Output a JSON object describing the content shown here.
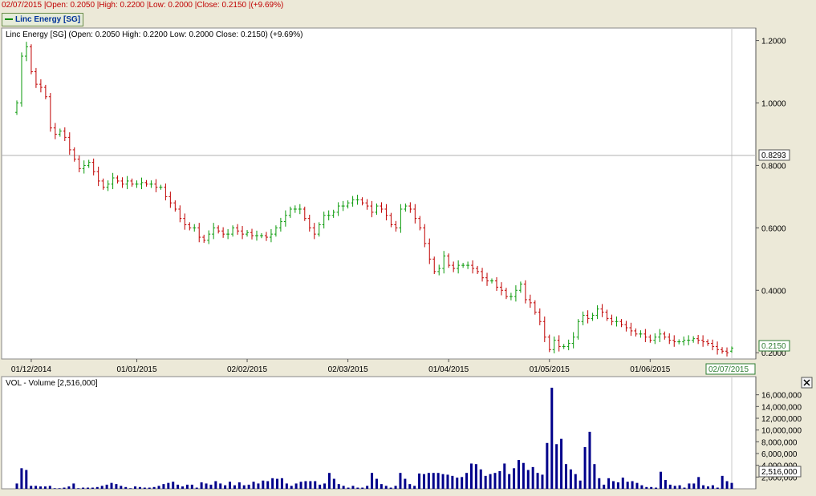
{
  "header": {
    "summary": "02/07/2015 |Open: 0.2050 |High: 0.2200 |Low: 0.2000 |Close: 0.2150 |(+9.69%)"
  },
  "tab": {
    "label": "Linc Energy [SG]"
  },
  "price_panel": {
    "title": "Linc Energy [SG] (Open: 0.2050  High: 0.2200  Low: 0.2000  Close: 0.2150) (+9.69%)",
    "crosshair_value": "0.8293",
    "last_value": "0.2150",
    "last_date": "02/07/2015",
    "colors": {
      "up": "#0a9a0a",
      "down": "#c00000"
    }
  },
  "volume_panel": {
    "title": "VOL - Volume [2,516,000]",
    "last_value": "2,516,000",
    "close_icon": "close-icon",
    "bar_color": "#00008b"
  },
  "chart_data": [
    {
      "type": "ohlc",
      "title": "Linc Energy [SG]",
      "ylim": [
        0.18,
        1.24
      ],
      "yticks": [
        "1.2000",
        "1.0000",
        "0.8000",
        "0.6000",
        "0.4000",
        "0.2000"
      ],
      "xticks": [
        "01/12/2014",
        "01/01/2015",
        "02/02/2015",
        "02/03/2015",
        "01/04/2015",
        "01/05/2015",
        "01/06/2015"
      ],
      "grid": false,
      "last_bar": {
        "date": "02/07/2015",
        "open": 0.205,
        "high": 0.22,
        "low": 0.2,
        "close": 0.215
      },
      "close_values": [
        1.0,
        1.15,
        1.18,
        1.1,
        1.06,
        1.05,
        1.02,
        0.92,
        0.9,
        0.91,
        0.89,
        0.85,
        0.82,
        0.79,
        0.8,
        0.81,
        0.78,
        0.75,
        0.73,
        0.74,
        0.76,
        0.75,
        0.74,
        0.75,
        0.74,
        0.74,
        0.745,
        0.74,
        0.74,
        0.73,
        0.73,
        0.7,
        0.68,
        0.66,
        0.63,
        0.61,
        0.6,
        0.6,
        0.57,
        0.56,
        0.58,
        0.6,
        0.59,
        0.58,
        0.58,
        0.6,
        0.59,
        0.58,
        0.585,
        0.575,
        0.575,
        0.575,
        0.57,
        0.58,
        0.6,
        0.62,
        0.64,
        0.66,
        0.66,
        0.66,
        0.63,
        0.6,
        0.58,
        0.61,
        0.64,
        0.64,
        0.65,
        0.67,
        0.67,
        0.68,
        0.69,
        0.69,
        0.68,
        0.67,
        0.65,
        0.67,
        0.66,
        0.64,
        0.61,
        0.6,
        0.66,
        0.67,
        0.66,
        0.63,
        0.6,
        0.55,
        0.5,
        0.46,
        0.47,
        0.51,
        0.48,
        0.47,
        0.48,
        0.48,
        0.48,
        0.47,
        0.46,
        0.44,
        0.43,
        0.43,
        0.41,
        0.4,
        0.38,
        0.38,
        0.4,
        0.42,
        0.37,
        0.36,
        0.33,
        0.3,
        0.25,
        0.21,
        0.24,
        0.22,
        0.22,
        0.23,
        0.25,
        0.3,
        0.32,
        0.31,
        0.32,
        0.34,
        0.33,
        0.31,
        0.3,
        0.3,
        0.29,
        0.28,
        0.27,
        0.26,
        0.26,
        0.25,
        0.24,
        0.25,
        0.26,
        0.25,
        0.24,
        0.235,
        0.235,
        0.24,
        0.24,
        0.245,
        0.24,
        0.235,
        0.23,
        0.22,
        0.21,
        0.205,
        0.2,
        0.215
      ]
    },
    {
      "type": "bar",
      "title": "VOL - Volume [2,516,000]",
      "ylim": [
        0,
        18000000
      ],
      "yticks": [
        "16,000,000",
        "14,000,000",
        "12,000,000",
        "10,000,000",
        "8,000,000",
        "6,000,000",
        "4,000,000",
        "2,000,000"
      ],
      "values": [
        900000,
        3500000,
        3200000,
        500000,
        500000,
        400000,
        400000,
        500000,
        100000,
        100000,
        200000,
        400000,
        900000,
        100000,
        200000,
        200000,
        200000,
        300000,
        500000,
        700000,
        1000000,
        800000,
        500000,
        300000,
        100000,
        400000,
        300000,
        200000,
        200000,
        300000,
        500000,
        800000,
        1000000,
        1200000,
        700000,
        400000,
        700000,
        700000,
        200000,
        1100000,
        900000,
        700000,
        1300000,
        900000,
        600000,
        1200000,
        600000,
        1100000,
        600000,
        700000,
        1200000,
        900000,
        1400000,
        1300000,
        1800000,
        1700000,
        1800000,
        900000,
        500000,
        900000,
        1200000,
        1300000,
        1300000,
        1300000,
        700000,
        900000,
        2700000,
        1700000,
        800000,
        500000,
        200000,
        500000,
        200000,
        200000,
        500000,
        2700000,
        1700000,
        800000,
        500000,
        200000,
        500000,
        2700000,
        1700000,
        800000,
        500000,
        2600000,
        2500000,
        2700000,
        2700000,
        2700000,
        2500000,
        2400000,
        2200000,
        1900000,
        2000000,
        2700000,
        4300000,
        4200000,
        3300000,
        2200000,
        2500000,
        2700000,
        3000000,
        4300000,
        2500000,
        3500000,
        4900000,
        4400000,
        3200000,
        3700000,
        2700000,
        2400000,
        7800000,
        17200000,
        7600000,
        8500000,
        4200000,
        3300000,
        2500000,
        1400000,
        7100000,
        9700000,
        4200000,
        1800000,
        700000,
        1800000,
        1300000,
        1100000,
        1900000,
        1200000,
        1300000,
        1000000,
        600000,
        300000,
        300000,
        200000,
        2900000,
        1500000,
        700000,
        500000,
        600000,
        200000,
        900000,
        900000,
        2000000,
        600000,
        400000,
        600000,
        200000,
        2200000,
        1300000,
        1000000
      ]
    }
  ]
}
